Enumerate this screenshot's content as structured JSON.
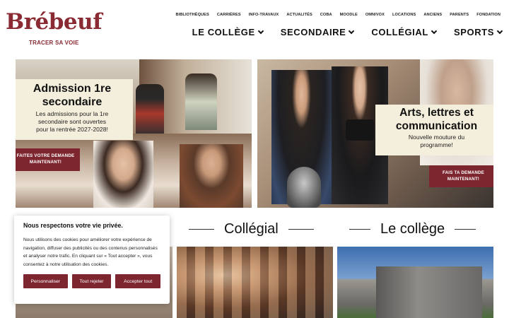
{
  "brand": {
    "logo_text": "Brébeuf",
    "tagline": "TRACER SA VOIE"
  },
  "utility_nav": [
    "BIBLIOTHÈQUES",
    "CARRIÈRES",
    "INFO-TRAVAUX",
    "ACTUALITÉS",
    "COBA",
    "MOODLE",
    "OMNIVOX",
    "LOCATIONS",
    "ANCIENS",
    "PARENTS",
    "FONDATION"
  ],
  "main_nav": [
    {
      "label": "LE COLLÈGE"
    },
    {
      "label": "SECONDAIRE"
    },
    {
      "label": "COLLÉGIAL"
    },
    {
      "label": "SPORTS"
    }
  ],
  "hero_left": {
    "title_line1": "Admission 1re",
    "title_line2": "secondaire",
    "text_line1": "Les admissions pour la 1re",
    "text_line2": "secondaire sont ouvertes",
    "text_line3": "pour la rentrée 2027-2028!",
    "cta_line1": "FAITES VOTRE DEMANDE",
    "cta_line2": "MAINTENANT!"
  },
  "hero_right": {
    "title_line1": "Arts, lettres et",
    "title_line2": "communication",
    "text_line1": "Nouvelle mouture du",
    "text_line2": "programme!",
    "cta_line1": "FAIS TA DEMANDE",
    "cta_line2": "MAINTENANT!"
  },
  "sections": {
    "collegial": "Collégial",
    "college": "Le collège"
  },
  "cookie": {
    "title": "Nous respectons votre vie privée.",
    "text": "Nous utilisons des cookies pour améliorer votre expérience de navigation, diffuser des publicités ou des contenus personnalisés et analyser notre trafic. En cliquant sur « Tout accepter », vous consentez à notre utilisation des cookies.",
    "btn_customize": "Personnaliser",
    "btn_reject": "Tout rejeter",
    "btn_accept": "Accepter tout"
  },
  "colors": {
    "brand": "#8a2a33",
    "cta": "#7d2630",
    "card": "#f4efdc"
  }
}
